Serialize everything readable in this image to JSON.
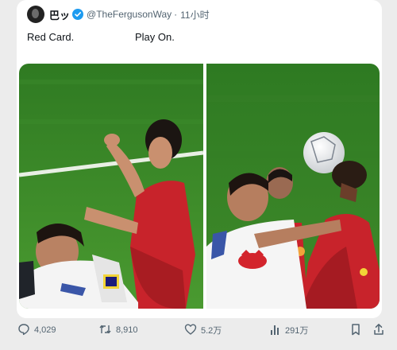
{
  "tweet": {
    "display_name": "巴ッ",
    "handle": "@TheFergusonWay",
    "separator": "·",
    "time": "11小时",
    "text_left": "Red Card.",
    "text_right": "Play On."
  },
  "actions": {
    "replies": "4,029",
    "retweets": "8,910",
    "likes": "5.2万",
    "views": "291万"
  },
  "colors": {
    "verified": "#1d9bf0",
    "text_secondary": "#536471",
    "pitch_green": "#3f8a2a",
    "home_kit": "#f4f4f4",
    "away_kit": "#c8232b"
  }
}
